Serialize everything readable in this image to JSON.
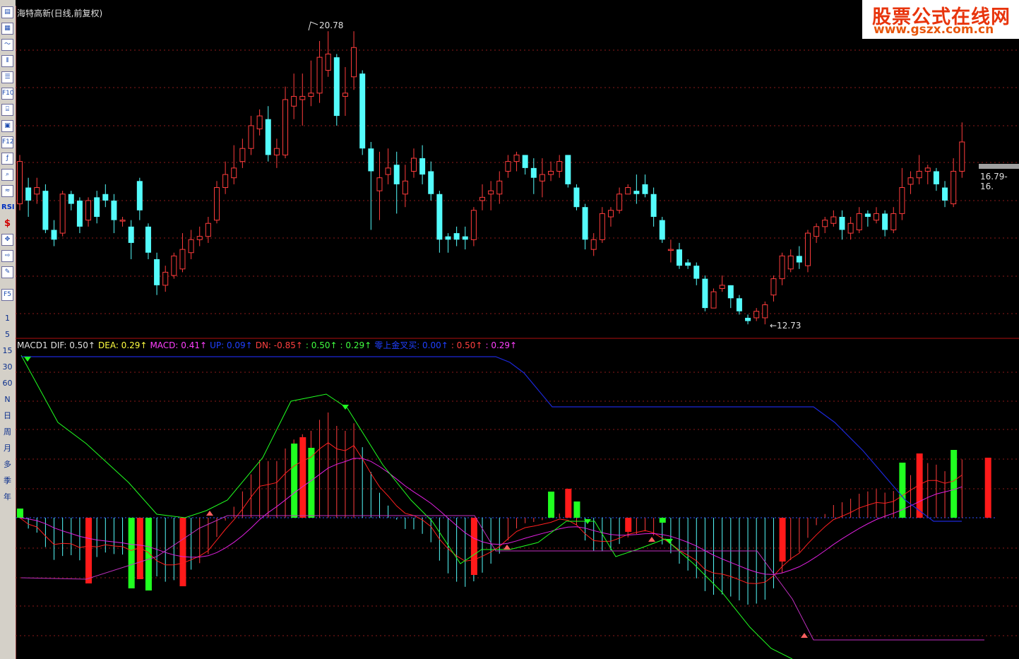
{
  "window": {
    "title": "海特高新(日线,前复权)"
  },
  "toolbar": {
    "icons": [
      "chart-icon",
      "table-icon",
      "line-icon",
      "candle-icon",
      "list-icon",
      "f10-icon",
      "tree-icon",
      "note-icon",
      "f12-icon",
      "formula-icon",
      "search-icon",
      "indicator-icon",
      "rsi-icon",
      "money-icon",
      "move-icon",
      "export-icon",
      "pen-icon",
      "f5-icon"
    ],
    "labels": {
      "f10": "F10",
      "f12": "F12",
      "rsi": "RSI",
      "f5": "F5"
    },
    "periods": [
      "1",
      "5",
      "15",
      "30",
      "60",
      "N",
      "日",
      "周",
      "月",
      "多",
      "季",
      "年"
    ]
  },
  "logo": {
    "line1": "股票公式在线网",
    "line2": "www.gszx.com.cn"
  },
  "price_pane": {
    "high_label": "20.78",
    "low_label": "←12.73",
    "price_tag": "16.79-16."
  },
  "macd_legend": [
    {
      "text": "MACD1",
      "color": "#e0e0e0"
    },
    {
      "text": "DIF: 0.50↑",
      "color": "#e0e0e0"
    },
    {
      "text": "DEA: 0.29↑",
      "color": "#ffff40"
    },
    {
      "text": "MACD: 0.41↑",
      "color": "#ff40ff"
    },
    {
      "text": "UP: 0.09↑",
      "color": "#2040ff"
    },
    {
      "text": "DN: -0.85↑",
      "color": "#ff4040"
    },
    {
      "text": ": 0.50↑",
      "color": "#40ff40"
    },
    {
      "text": ": 0.29↑",
      "color": "#40ff40"
    },
    {
      "text": "零上金叉买: 0.00↑",
      "color": "#2040ff"
    },
    {
      "text": ": 0.50↑",
      "color": "#ff4040"
    },
    {
      "text": ": 0.29↑",
      "color": "#ff40ff"
    }
  ],
  "colors": {
    "up": "#ff3c3c",
    "down": "#54fcfc",
    "grid": "#8b1a1a",
    "dif": "#ff2020",
    "dea": "#e020e0",
    "green": "#20ff20",
    "blue": "#1c28d8"
  },
  "chart_data": {
    "type": "candlestick",
    "candles": [
      {
        "o": 15.5,
        "c": 16.8,
        "h": 17.0,
        "l": 15.3
      },
      {
        "o": 16.0,
        "c": 15.6,
        "h": 16.3,
        "l": 15.1
      },
      {
        "o": 15.8,
        "c": 16.0,
        "h": 16.3,
        "l": 15.5
      },
      {
        "o": 15.9,
        "c": 14.7,
        "h": 16.1,
        "l": 14.6
      },
      {
        "o": 14.7,
        "c": 14.4,
        "h": 15.0,
        "l": 14.2
      },
      {
        "o": 14.6,
        "c": 15.8,
        "h": 15.9,
        "l": 14.5
      },
      {
        "o": 15.8,
        "c": 15.5,
        "h": 15.9,
        "l": 15.3
      },
      {
        "o": 15.6,
        "c": 14.8,
        "h": 15.7,
        "l": 14.6
      },
      {
        "o": 15.0,
        "c": 15.6,
        "h": 15.7,
        "l": 14.8
      },
      {
        "o": 15.7,
        "c": 15.1,
        "h": 15.9,
        "l": 14.9
      },
      {
        "o": 15.8,
        "c": 15.6,
        "h": 16.1,
        "l": 15.4
      },
      {
        "o": 15.6,
        "c": 15.0,
        "h": 15.8,
        "l": 14.6
      },
      {
        "o": 15.0,
        "c": 15.0,
        "h": 15.1,
        "l": 14.8
      },
      {
        "o": 14.8,
        "c": 14.3,
        "h": 15.0,
        "l": 13.8
      },
      {
        "o": 16.2,
        "c": 15.3,
        "h": 16.3,
        "l": 15.0
      },
      {
        "o": 14.8,
        "c": 14.0,
        "h": 14.9,
        "l": 13.8
      },
      {
        "o": 13.8,
        "c": 13.0,
        "h": 14.0,
        "l": 12.7
      },
      {
        "o": 13.0,
        "c": 13.4,
        "h": 13.6,
        "l": 12.8
      },
      {
        "o": 13.3,
        "c": 13.9,
        "h": 14.0,
        "l": 13.2
      },
      {
        "o": 13.5,
        "c": 14.1,
        "h": 14.6,
        "l": 13.4
      },
      {
        "o": 14.0,
        "c": 14.4,
        "h": 14.7,
        "l": 13.8
      },
      {
        "o": 14.4,
        "c": 14.5,
        "h": 14.8,
        "l": 14.2
      },
      {
        "o": 14.5,
        "c": 14.9,
        "h": 15.1,
        "l": 14.3
      },
      {
        "o": 15.0,
        "c": 16.0,
        "h": 16.2,
        "l": 14.9
      },
      {
        "o": 16.0,
        "c": 16.4,
        "h": 16.8,
        "l": 15.8
      },
      {
        "o": 16.3,
        "c": 16.6,
        "h": 17.3,
        "l": 16.1
      },
      {
        "o": 16.8,
        "c": 17.2,
        "h": 17.5,
        "l": 16.6
      },
      {
        "o": 17.2,
        "c": 17.9,
        "h": 18.2,
        "l": 17.0
      },
      {
        "o": 17.8,
        "c": 18.2,
        "h": 18.4,
        "l": 17.6
      },
      {
        "o": 18.1,
        "c": 17.0,
        "h": 18.5,
        "l": 16.8
      },
      {
        "o": 17.0,
        "c": 17.2,
        "h": 17.5,
        "l": 16.6
      },
      {
        "o": 17.0,
        "c": 18.7,
        "h": 19.1,
        "l": 16.9
      },
      {
        "o": 18.5,
        "c": 18.8,
        "h": 19.5,
        "l": 18.1
      },
      {
        "o": 18.7,
        "c": 18.8,
        "h": 19.5,
        "l": 17.9
      },
      {
        "o": 18.8,
        "c": 18.9,
        "h": 19.9,
        "l": 18.5
      },
      {
        "o": 18.9,
        "c": 20.0,
        "h": 20.5,
        "l": 18.6
      },
      {
        "o": 19.6,
        "c": 20.1,
        "h": 20.8,
        "l": 19.4
      },
      {
        "o": 20.0,
        "c": 18.2,
        "h": 20.1,
        "l": 17.9
      },
      {
        "o": 18.8,
        "c": 18.9,
        "h": 19.7,
        "l": 18.2
      },
      {
        "o": 19.4,
        "c": 20.3,
        "h": 20.8,
        "l": 19.0
      },
      {
        "o": 19.5,
        "c": 17.2,
        "h": 19.6,
        "l": 17.0
      },
      {
        "o": 17.2,
        "c": 16.5,
        "h": 17.4,
        "l": 14.7
      },
      {
        "o": 15.9,
        "c": 16.3,
        "h": 17.1,
        "l": 15.0
      },
      {
        "o": 16.4,
        "c": 16.6,
        "h": 17.2,
        "l": 16.1
      },
      {
        "o": 16.7,
        "c": 16.1,
        "h": 17.1,
        "l": 15.2
      },
      {
        "o": 15.8,
        "c": 16.2,
        "h": 16.7,
        "l": 15.4
      },
      {
        "o": 16.5,
        "c": 16.9,
        "h": 17.2,
        "l": 16.3
      },
      {
        "o": 16.9,
        "c": 16.4,
        "h": 17.3,
        "l": 16.1
      },
      {
        "o": 16.5,
        "c": 15.8,
        "h": 16.8,
        "l": 15.6
      },
      {
        "o": 15.8,
        "c": 14.4,
        "h": 15.9,
        "l": 14.0
      },
      {
        "o": 14.5,
        "c": 14.4,
        "h": 14.6,
        "l": 14.0
      },
      {
        "o": 14.6,
        "c": 14.4,
        "h": 14.8,
        "l": 14.2
      },
      {
        "o": 14.5,
        "c": 14.4,
        "h": 14.8,
        "l": 14.1
      },
      {
        "o": 14.4,
        "c": 15.3,
        "h": 15.4,
        "l": 14.2
      },
      {
        "o": 15.6,
        "c": 15.7,
        "h": 16.1,
        "l": 15.3
      },
      {
        "o": 15.8,
        "c": 15.9,
        "h": 16.2,
        "l": 15.3
      },
      {
        "o": 15.8,
        "c": 16.2,
        "h": 16.5,
        "l": 15.5
      },
      {
        "o": 16.5,
        "c": 16.8,
        "h": 17.0,
        "l": 16.3
      },
      {
        "o": 16.8,
        "c": 17.0,
        "h": 17.1,
        "l": 16.5
      },
      {
        "o": 17.0,
        "c": 16.6,
        "h": 17.0,
        "l": 16.4
      },
      {
        "o": 16.6,
        "c": 16.3,
        "h": 16.9,
        "l": 15.8
      },
      {
        "o": 16.2,
        "c": 16.4,
        "h": 16.9,
        "l": 15.7
      },
      {
        "o": 16.4,
        "c": 16.5,
        "h": 16.8,
        "l": 16.2
      },
      {
        "o": 16.5,
        "c": 16.8,
        "h": 17.0,
        "l": 16.3
      },
      {
        "o": 17.0,
        "c": 16.1,
        "h": 17.0,
        "l": 16.0
      },
      {
        "o": 16.0,
        "c": 15.4,
        "h": 16.1,
        "l": 15.3
      },
      {
        "o": 15.4,
        "c": 14.4,
        "h": 15.5,
        "l": 14.1
      },
      {
        "o": 14.1,
        "c": 14.4,
        "h": 14.6,
        "l": 13.9
      },
      {
        "o": 14.4,
        "c": 15.2,
        "h": 15.4,
        "l": 14.3
      },
      {
        "o": 15.1,
        "c": 15.3,
        "h": 15.4,
        "l": 14.8
      },
      {
        "o": 15.3,
        "c": 15.8,
        "h": 16.0,
        "l": 15.2
      },
      {
        "o": 15.8,
        "c": 16.0,
        "h": 16.1,
        "l": 15.8
      },
      {
        "o": 15.9,
        "c": 15.8,
        "h": 16.4,
        "l": 15.5
      },
      {
        "o": 16.1,
        "c": 15.8,
        "h": 16.4,
        "l": 15.7
      },
      {
        "o": 15.8,
        "c": 15.1,
        "h": 16.0,
        "l": 14.8
      },
      {
        "o": 15.0,
        "c": 14.4,
        "h": 15.1,
        "l": 14.3
      },
      {
        "o": 14.1,
        "c": 14.1,
        "h": 14.4,
        "l": 13.7
      },
      {
        "o": 14.1,
        "c": 13.6,
        "h": 14.3,
        "l": 13.5
      },
      {
        "o": 13.7,
        "c": 13.6,
        "h": 13.8,
        "l": 13.5
      },
      {
        "o": 13.6,
        "c": 13.2,
        "h": 13.7,
        "l": 13.0
      },
      {
        "o": 13.2,
        "c": 12.3,
        "h": 13.3,
        "l": 12.2
      },
      {
        "o": 12.3,
        "c": 12.8,
        "h": 12.9,
        "l": 12.3
      },
      {
        "o": 12.9,
        "c": 13.0,
        "h": 13.3,
        "l": 12.8
      },
      {
        "o": 13.0,
        "c": 12.6,
        "h": 13.0,
        "l": 12.3
      },
      {
        "o": 12.6,
        "c": 12.2,
        "h": 12.7,
        "l": 12.1
      },
      {
        "o": 12.0,
        "c": 11.9,
        "h": 12.1,
        "l": 11.8
      },
      {
        "o": 12.0,
        "c": 12.2,
        "h": 12.3,
        "l": 11.9
      },
      {
        "o": 12.0,
        "c": 12.4,
        "h": 12.5,
        "l": 11.8
      },
      {
        "o": 12.7,
        "c": 13.2,
        "h": 13.3,
        "l": 12.5
      },
      {
        "o": 13.2,
        "c": 13.9,
        "h": 14.0,
        "l": 13.0
      },
      {
        "o": 13.5,
        "c": 13.9,
        "h": 14.1,
        "l": 13.4
      },
      {
        "o": 13.9,
        "c": 13.7,
        "h": 14.2,
        "l": 13.5
      },
      {
        "o": 13.6,
        "c": 14.6,
        "h": 14.7,
        "l": 13.4
      },
      {
        "o": 14.5,
        "c": 14.8,
        "h": 14.9,
        "l": 14.3
      },
      {
        "o": 14.8,
        "c": 15.0,
        "h": 15.1,
        "l": 14.6
      },
      {
        "o": 14.9,
        "c": 15.1,
        "h": 15.3,
        "l": 14.8
      },
      {
        "o": 15.1,
        "c": 14.7,
        "h": 15.3,
        "l": 14.4
      },
      {
        "o": 14.6,
        "c": 14.9,
        "h": 15.1,
        "l": 14.4
      },
      {
        "o": 14.7,
        "c": 15.2,
        "h": 15.4,
        "l": 14.6
      },
      {
        "o": 15.2,
        "c": 15.1,
        "h": 15.3,
        "l": 14.8
      },
      {
        "o": 15.0,
        "c": 15.2,
        "h": 15.4,
        "l": 14.9
      },
      {
        "o": 15.2,
        "c": 14.7,
        "h": 15.3,
        "l": 14.5
      },
      {
        "o": 14.7,
        "c": 15.2,
        "h": 15.4,
        "l": 14.6
      },
      {
        "o": 15.2,
        "c": 16.0,
        "h": 16.6,
        "l": 15.0
      },
      {
        "o": 16.1,
        "c": 16.3,
        "h": 16.5,
        "l": 15.8
      },
      {
        "o": 16.3,
        "c": 16.5,
        "h": 17.0,
        "l": 16.1
      },
      {
        "o": 16.5,
        "c": 16.6,
        "h": 16.7,
        "l": 16.1
      },
      {
        "o": 16.5,
        "c": 16.1,
        "h": 16.6,
        "l": 15.9
      },
      {
        "o": 16.0,
        "c": 15.6,
        "h": 16.2,
        "l": 15.4
      },
      {
        "o": 15.5,
        "c": 16.5,
        "h": 16.9,
        "l": 15.4
      },
      {
        "o": 16.5,
        "c": 17.4,
        "h": 18.0,
        "l": 16.3
      }
    ]
  }
}
